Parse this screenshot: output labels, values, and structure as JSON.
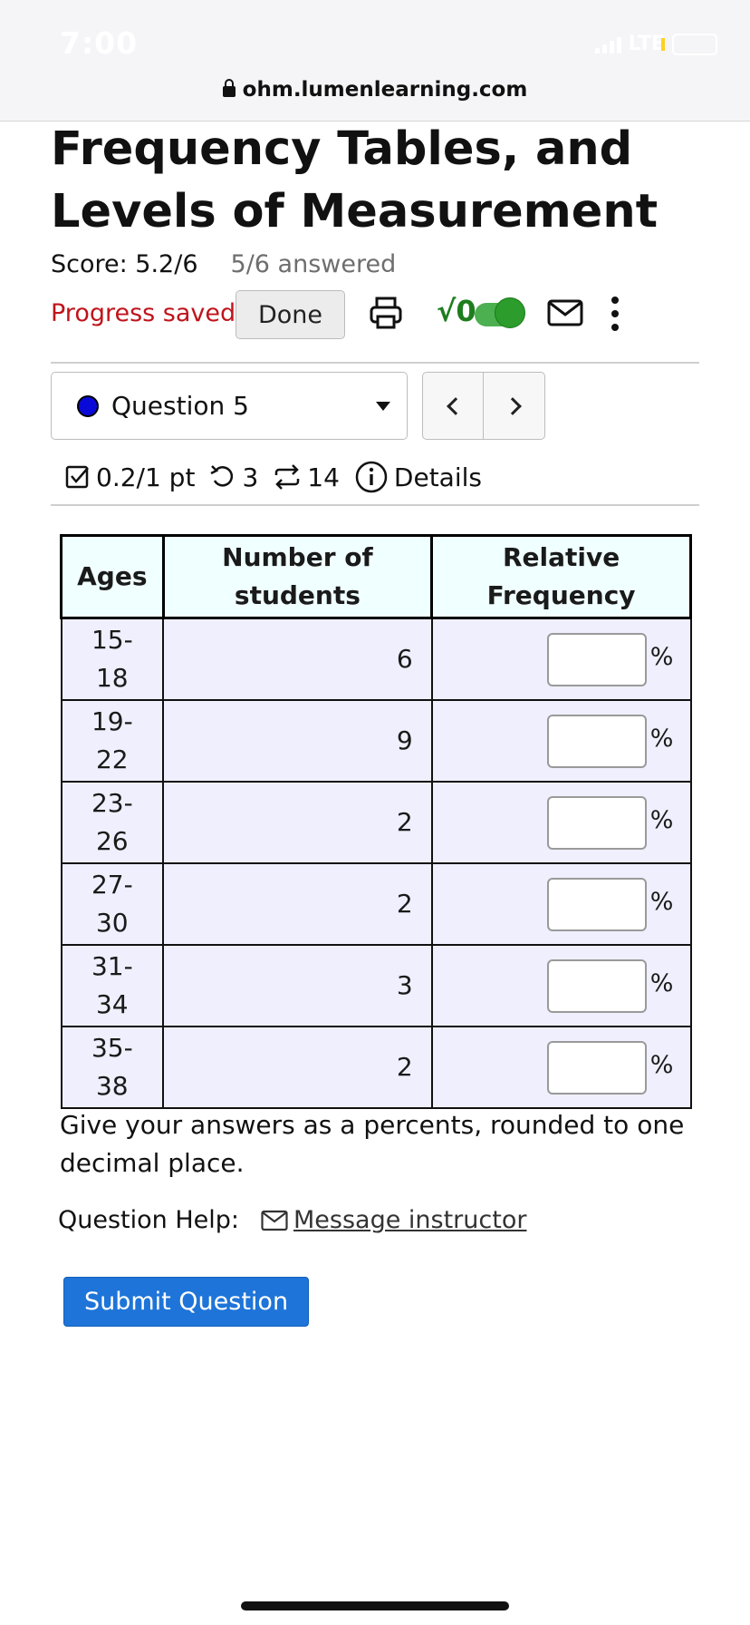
{
  "status_bar": {
    "time": "7:00",
    "network": "LTE"
  },
  "browser": {
    "url": "ohm.lumenlearning.com"
  },
  "page": {
    "title": "Frequency Tables, and Levels of Measurement"
  },
  "score": {
    "label": "Score: 5.2/6",
    "answered": "5/6 answered"
  },
  "toolbar": {
    "progress_saved": "Progress saved",
    "done_label": "Done",
    "math_label": "√0"
  },
  "question": {
    "selected": "Question 5"
  },
  "meta": {
    "points": "0.2/1 pt",
    "retries": "3",
    "attempts": "14",
    "details": "Details"
  },
  "table": {
    "headers": [
      "Ages",
      "Number of students",
      "Relative Frequency"
    ],
    "unit": "%",
    "rows": [
      {
        "ages": "15-18",
        "students": "6",
        "relative": ""
      },
      {
        "ages": "19-22",
        "students": "9",
        "relative": ""
      },
      {
        "ages": "23-26",
        "students": "2",
        "relative": ""
      },
      {
        "ages": "27-30",
        "students": "2",
        "relative": ""
      },
      {
        "ages": "31-34",
        "students": "3",
        "relative": ""
      },
      {
        "ages": "35-38",
        "students": "2",
        "relative": ""
      }
    ]
  },
  "instructions": "Give your answers as a percents, rounded to one decimal place.",
  "help": {
    "label": "Question Help:",
    "message_link": "Message instructor"
  },
  "submit_label": "Submit Question",
  "colors": {
    "accent": "#1e74d8",
    "error_red": "#c0141b",
    "green": "#2c9c2c",
    "header_bg": "#f0ffff",
    "cell_bg": "#efeffd"
  }
}
